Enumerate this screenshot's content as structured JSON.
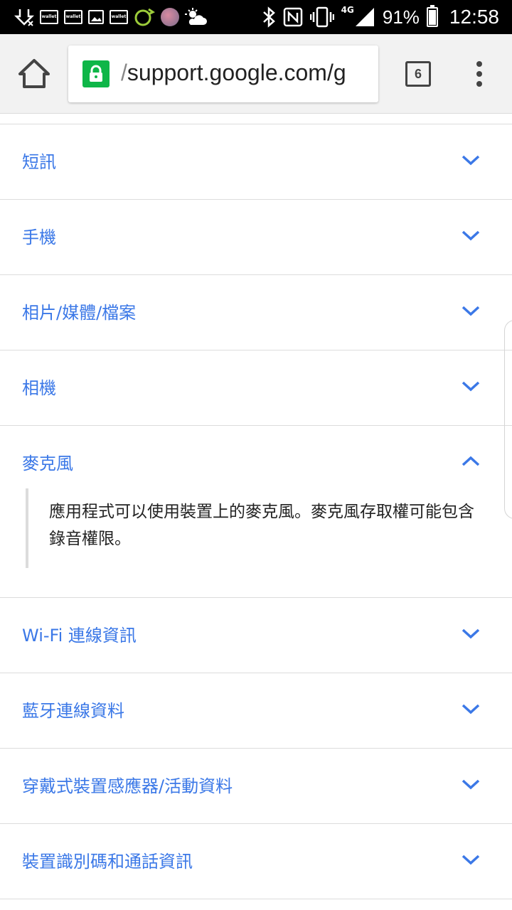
{
  "status_bar": {
    "wallet_label": "wallet",
    "network": "4G",
    "battery": "91%",
    "time": "12:58",
    "icons": [
      "download-icon",
      "wallet-icon",
      "wallet-icon",
      "gallery-icon",
      "wallet-icon",
      "eco-icon",
      "avatar",
      "weather-icon",
      "bluetooth-icon",
      "nfc-icon",
      "vibrate-icon",
      "signal-icon",
      "battery-icon"
    ]
  },
  "toolbar": {
    "url_prefix": "/",
    "url": "support.google.com/g",
    "tab_count": "6",
    "secure_color": "#0fb648"
  },
  "accordion": {
    "accent_color": "#3b78e7",
    "items": [
      {
        "label": "短訊",
        "expanded": false
      },
      {
        "label": "手機",
        "expanded": false
      },
      {
        "label": "相片/媒體/檔案",
        "expanded": false
      },
      {
        "label": "相機",
        "expanded": false
      },
      {
        "label": "麥克風",
        "expanded": true,
        "body": "應用程式可以使用裝置上的麥克風。麥克風存取權可能包含錄音權限。"
      },
      {
        "label": "Wi-Fi 連線資訊",
        "expanded": false
      },
      {
        "label": "藍牙連線資料",
        "expanded": false
      },
      {
        "label": "穿戴式裝置感應器/活動資料",
        "expanded": false
      },
      {
        "label": "裝置識別碼和通話資訊",
        "expanded": false
      }
    ]
  }
}
